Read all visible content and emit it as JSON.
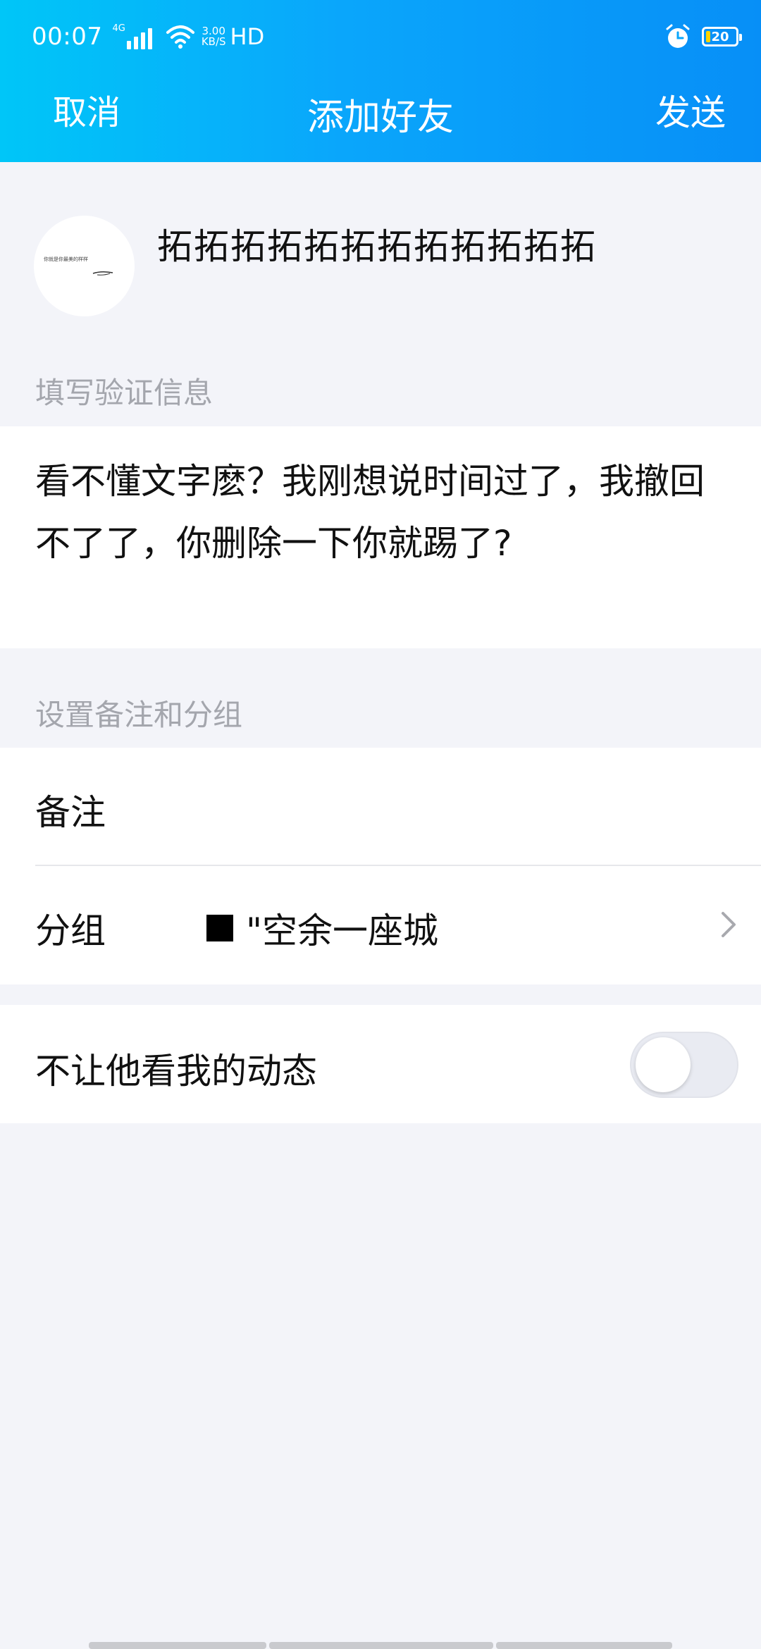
{
  "status_bar": {
    "time": "00:07",
    "network": "4G",
    "speed_value": "3.00",
    "speed_unit": "KB/S",
    "hd": "HD",
    "battery": "20"
  },
  "nav": {
    "cancel": "取消",
    "title": "添加好友",
    "send": "发送"
  },
  "profile": {
    "name": "拓拓拓拓拓拓拓拓拓拓拓拓",
    "avatar_caption": "你就是你最美的样样"
  },
  "verification": {
    "label": "填写验证信息",
    "message": "看不懂文字麽？我刚想说时间过了，我撤回不了了，你删除一下你就踢了?"
  },
  "settings": {
    "label": "设置备注和分组",
    "remark_label": "备注",
    "group_label": "分组",
    "group_value": "\"空余一座城"
  },
  "privacy": {
    "label": "不让他看我的动态",
    "enabled": false
  },
  "colors": {
    "header_gradient_start": "#00c6f8",
    "header_gradient_end": "#078ff7",
    "page_background": "#f3f4f9",
    "section_label": "#a4a6ad",
    "battery_fill": "#ffd400"
  }
}
